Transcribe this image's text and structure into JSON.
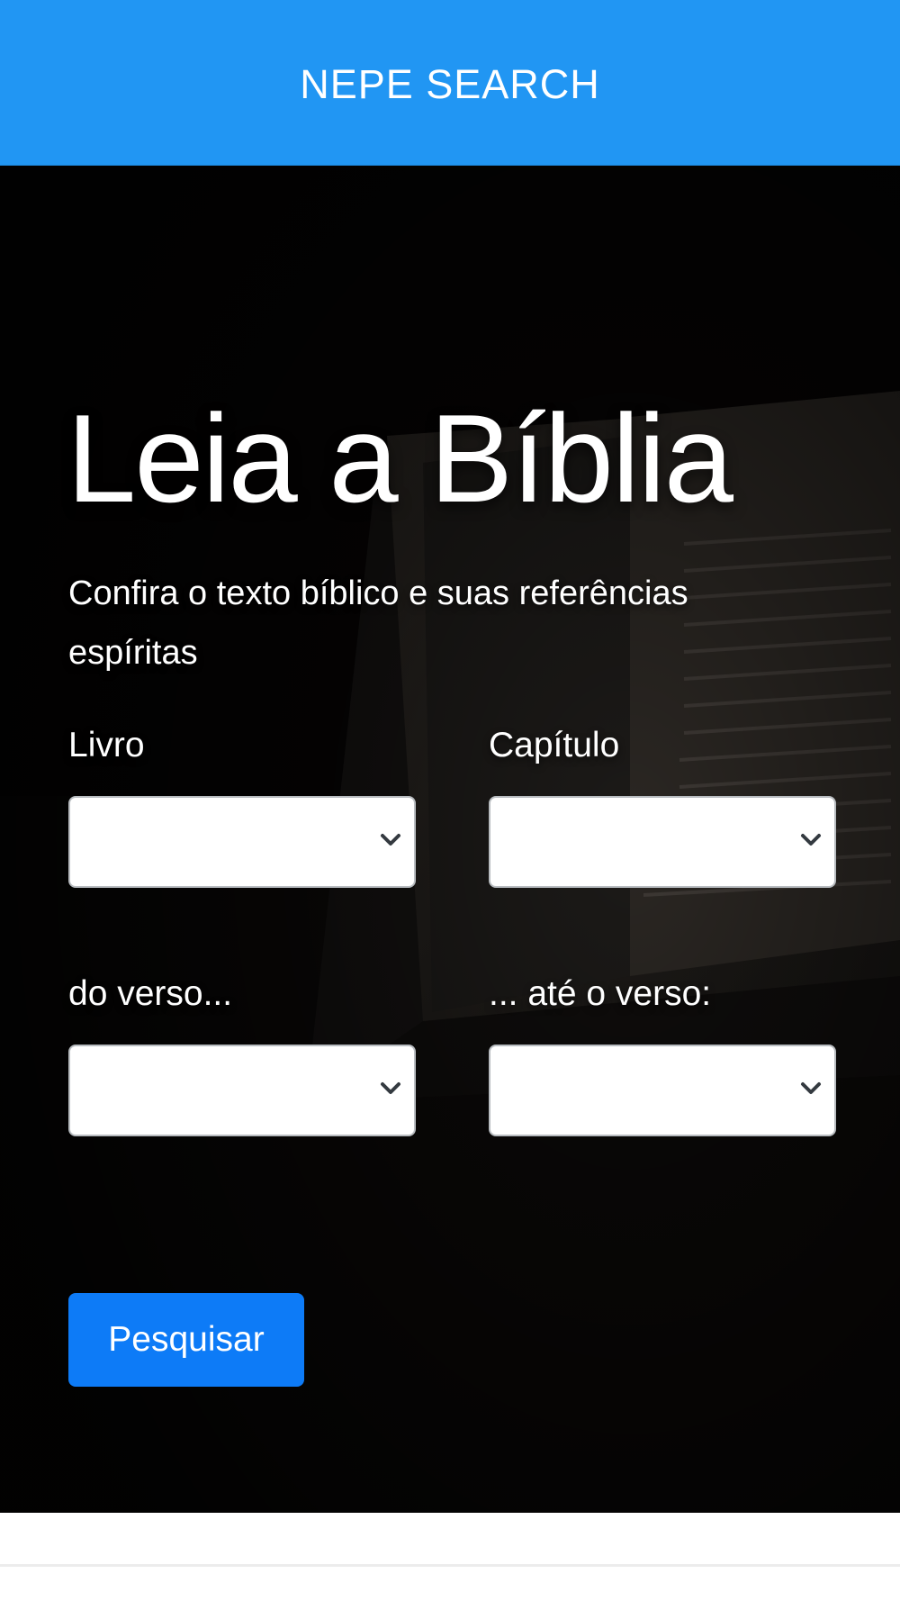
{
  "navbar": {
    "brand": "NEPE SEARCH",
    "color": "#2196f3"
  },
  "hero": {
    "title": "Leia a Bíblia",
    "subtitle": "Confira o texto bíblico e suas referências espíritas",
    "background_image": "open-bible-dark-photo"
  },
  "form": {
    "book": {
      "label": "Livro",
      "value": ""
    },
    "chapter": {
      "label": "Capítulo",
      "value": ""
    },
    "verse_from": {
      "label": "do verso...",
      "value": ""
    },
    "verse_to": {
      "label": "... até o verso:",
      "value": ""
    },
    "submit_label": "Pesquisar",
    "submit_color": "#0d7bf7"
  },
  "icons": {
    "select_arrow": "chevron-down-icon"
  }
}
